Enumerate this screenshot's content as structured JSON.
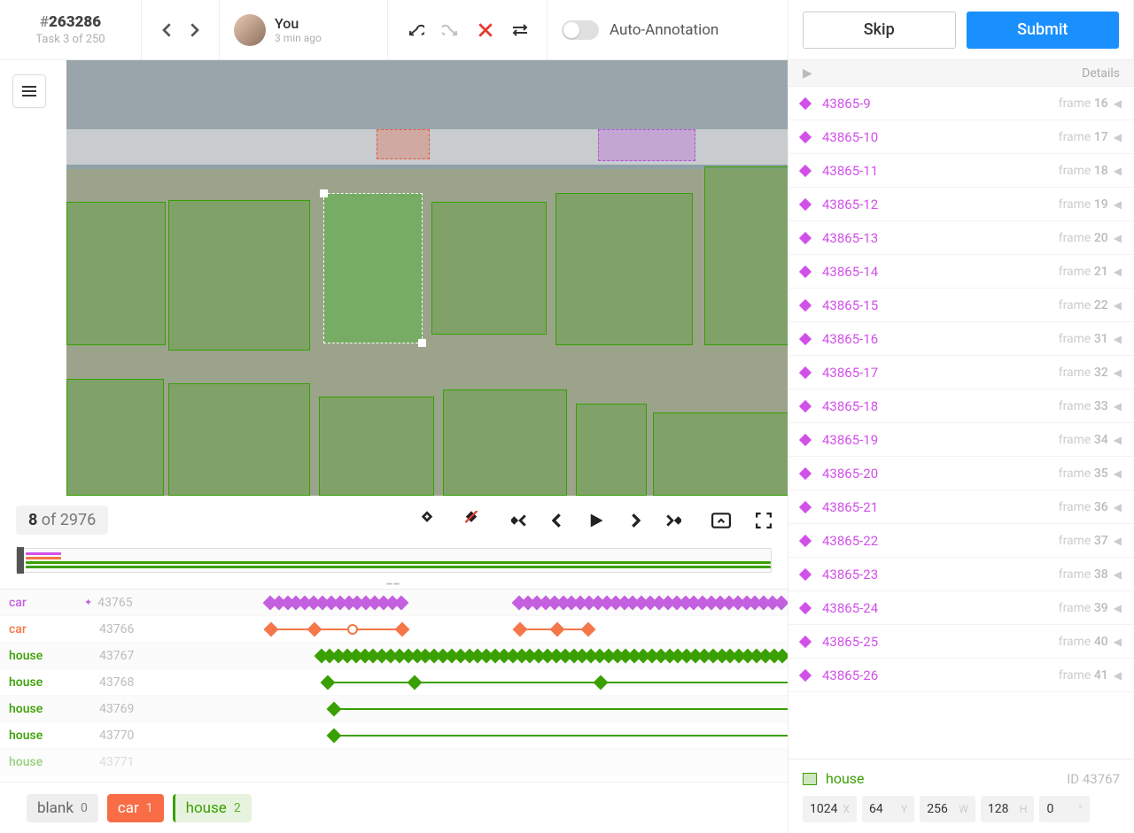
{
  "header": {
    "task_hash": "#",
    "task_num": "263286",
    "task_sub": "Task 3 of 250",
    "user_name": "You",
    "user_time": "3 min ago",
    "auto_label": "Auto-Annotation",
    "skip": "Skip",
    "submit": "Submit"
  },
  "frame": {
    "cur": "8",
    "of": " of 2976"
  },
  "tracks": [
    {
      "label": "car",
      "cls": "car-p",
      "id": "43765"
    },
    {
      "label": "car",
      "cls": "car-o",
      "id": "43766"
    },
    {
      "label": "house",
      "cls": "house",
      "id": "43767"
    },
    {
      "label": "house",
      "cls": "house",
      "id": "43768"
    },
    {
      "label": "house",
      "cls": "house",
      "id": "43769"
    },
    {
      "label": "house",
      "cls": "house",
      "id": "43770"
    },
    {
      "label": "house",
      "cls": "house",
      "id": "43771"
    }
  ],
  "chips": {
    "blank_l": "blank",
    "blank_c": "0",
    "car_l": "car",
    "car_c": "1",
    "house_l": "house",
    "house_c": "2"
  },
  "details_title": "Details",
  "regions": [
    {
      "id": "43865-9",
      "fr": "16"
    },
    {
      "id": "43865-10",
      "fr": "17"
    },
    {
      "id": "43865-11",
      "fr": "18"
    },
    {
      "id": "43865-12",
      "fr": "19"
    },
    {
      "id": "43865-13",
      "fr": "20"
    },
    {
      "id": "43865-14",
      "fr": "21"
    },
    {
      "id": "43865-15",
      "fr": "22"
    },
    {
      "id": "43865-16",
      "fr": "31"
    },
    {
      "id": "43865-17",
      "fr": "32"
    },
    {
      "id": "43865-18",
      "fr": "33"
    },
    {
      "id": "43865-19",
      "fr": "34"
    },
    {
      "id": "43865-20",
      "fr": "35"
    },
    {
      "id": "43865-21",
      "fr": "36"
    },
    {
      "id": "43865-22",
      "fr": "37"
    },
    {
      "id": "43865-23",
      "fr": "38"
    },
    {
      "id": "43865-24",
      "fr": "39"
    },
    {
      "id": "43865-25",
      "fr": "40"
    },
    {
      "id": "43865-26",
      "fr": "41"
    }
  ],
  "selection": {
    "name": "house",
    "id_prefix": "ID ",
    "id": "43767",
    "x": "1024",
    "xu": "X",
    "y": "64",
    "yu": "Y",
    "w": "256",
    "wu": "W",
    "h": "128",
    "hu": "H",
    "r": "0",
    "ru": "°"
  },
  "frame_word": "frame "
}
